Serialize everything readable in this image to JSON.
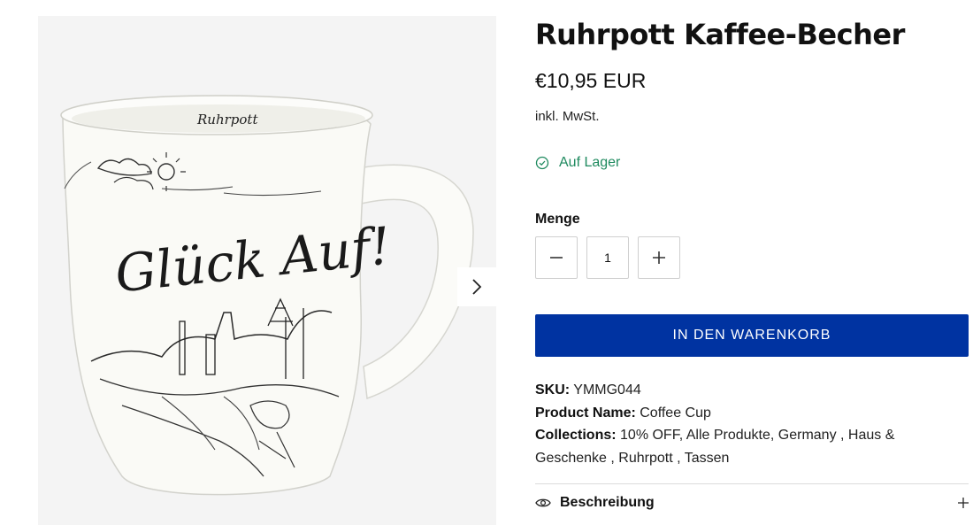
{
  "product": {
    "title": "Ruhrpott Kaffee-Becher",
    "price": "€10,95 EUR",
    "tax_note": "inkl. MwSt.",
    "stock_status": "Auf Lager",
    "quantity_label": "Menge",
    "quantity_value": "1",
    "add_to_cart_label": "IN DEN WARENKORB",
    "sku_label": "SKU:",
    "sku_value": "YMMG044",
    "product_name_label": "Product Name:",
    "product_name_value": "Coffee Cup",
    "collections_label": "Collections:",
    "collections_value": "10% OFF, Alle Produkte, Germany , Haus & Geschenke , Ruhrpott , Tassen",
    "description_label": "Beschreibung"
  },
  "image": {
    "mug_text": "Glück Auf!",
    "rim_text": "Ruhrpott"
  },
  "icons": {
    "stock": "check-circle-icon",
    "minus": "minus-icon",
    "plus": "plus-icon",
    "next": "chevron-right-icon",
    "description": "eye-icon",
    "expand": "plus-icon"
  },
  "colors": {
    "accent": "#0033a1",
    "stock": "#1f8a5f",
    "gallery_bg": "#f4f4f4"
  }
}
